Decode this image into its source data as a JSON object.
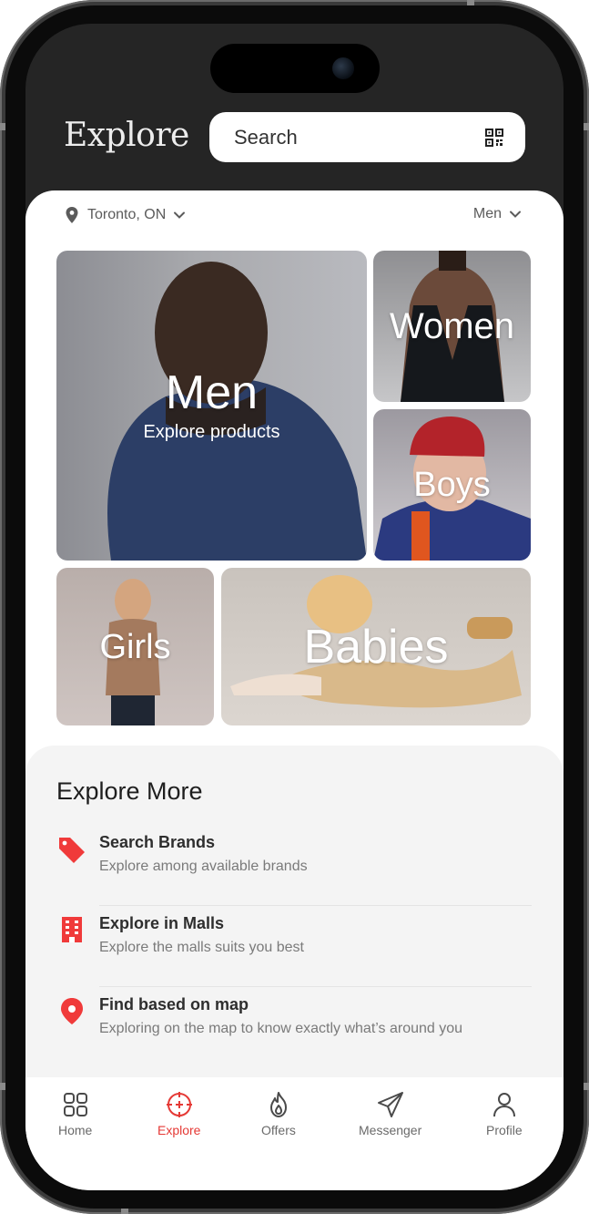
{
  "header": {
    "title": "Explore",
    "search_placeholder": "Search"
  },
  "location": {
    "city": "Toronto, ON",
    "category": "Men"
  },
  "tiles": {
    "men": {
      "label": "Men",
      "sub": "Explore products"
    },
    "women": {
      "label": "Women"
    },
    "boys": {
      "label": "Boys"
    },
    "girls": {
      "label": "Girls"
    },
    "babies": {
      "label": "Babies"
    }
  },
  "explore_more": {
    "title": "Explore More",
    "options": [
      {
        "title": "Search Brands",
        "sub": "Explore among available brands",
        "icon": "tag-icon"
      },
      {
        "title": "Explore in Malls",
        "sub": "Explore the malls suits you best",
        "icon": "building-icon"
      },
      {
        "title": "Find based on map",
        "sub": "Exploring on the map to know exactly what’s around you",
        "icon": "map-pin-icon"
      }
    ]
  },
  "tabbar": {
    "items": [
      {
        "label": "Home",
        "icon": "grid-icon",
        "active": false
      },
      {
        "label": "Explore",
        "icon": "crosshair-icon",
        "active": true
      },
      {
        "label": "Offers",
        "icon": "flame-icon",
        "active": false
      },
      {
        "label": "Messenger",
        "icon": "send-icon",
        "active": false
      },
      {
        "label": "Profile",
        "icon": "user-icon",
        "active": false
      }
    ]
  },
  "colors": {
    "accent": "#E53935",
    "header_bg": "#252525",
    "sheet_bg": "#F4F4F4"
  }
}
